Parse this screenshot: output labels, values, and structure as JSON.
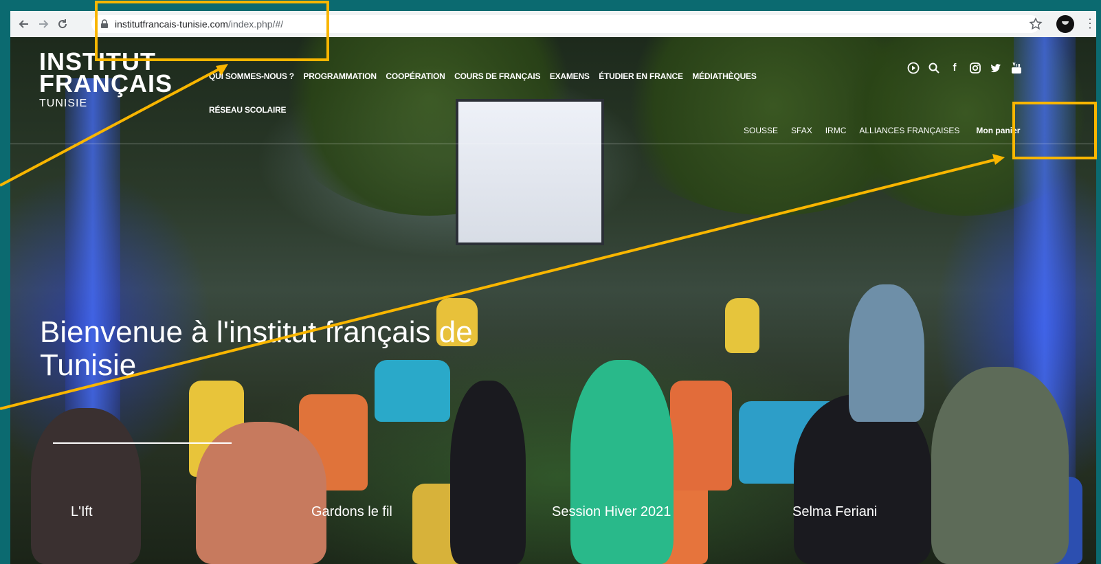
{
  "browser": {
    "url_host": "institutfrancais-tunisie.com",
    "url_path": "/index.php/#/"
  },
  "logo": {
    "line1": "INSTITUT",
    "line2": "FRANÇAIS",
    "line3": "TUNISIE"
  },
  "main_nav": {
    "items": [
      "QUI SOMMES-NOUS ?",
      "PROGRAMMATION",
      "COOPÉRATION",
      "COURS DE FRANÇAIS",
      "EXAMENS",
      "ÉTUDIER EN FRANCE",
      "MÉDIATHÈQUES"
    ],
    "row2": "RÉSEAU SCOLAIRE"
  },
  "sub_nav": {
    "items": [
      "SOUSSE",
      "SFAX",
      "IRMC",
      "ALLIANCES FRANÇAISES"
    ],
    "panier": "Mon panier"
  },
  "social_icons": [
    "play-icon",
    "search-icon",
    "facebook-icon",
    "instagram-icon",
    "twitter-icon",
    "youtube-icon"
  ],
  "hero": {
    "title_line1": "Bienvenue à l'institut français de",
    "title_line2": "Tunisie"
  },
  "tabs": [
    "L'Ift",
    "Gardons le fil",
    "Session Hiver 2021",
    "Selma Feriani"
  ],
  "colors": {
    "annotation": "#f9b600",
    "page_border": "#0b6a70"
  }
}
